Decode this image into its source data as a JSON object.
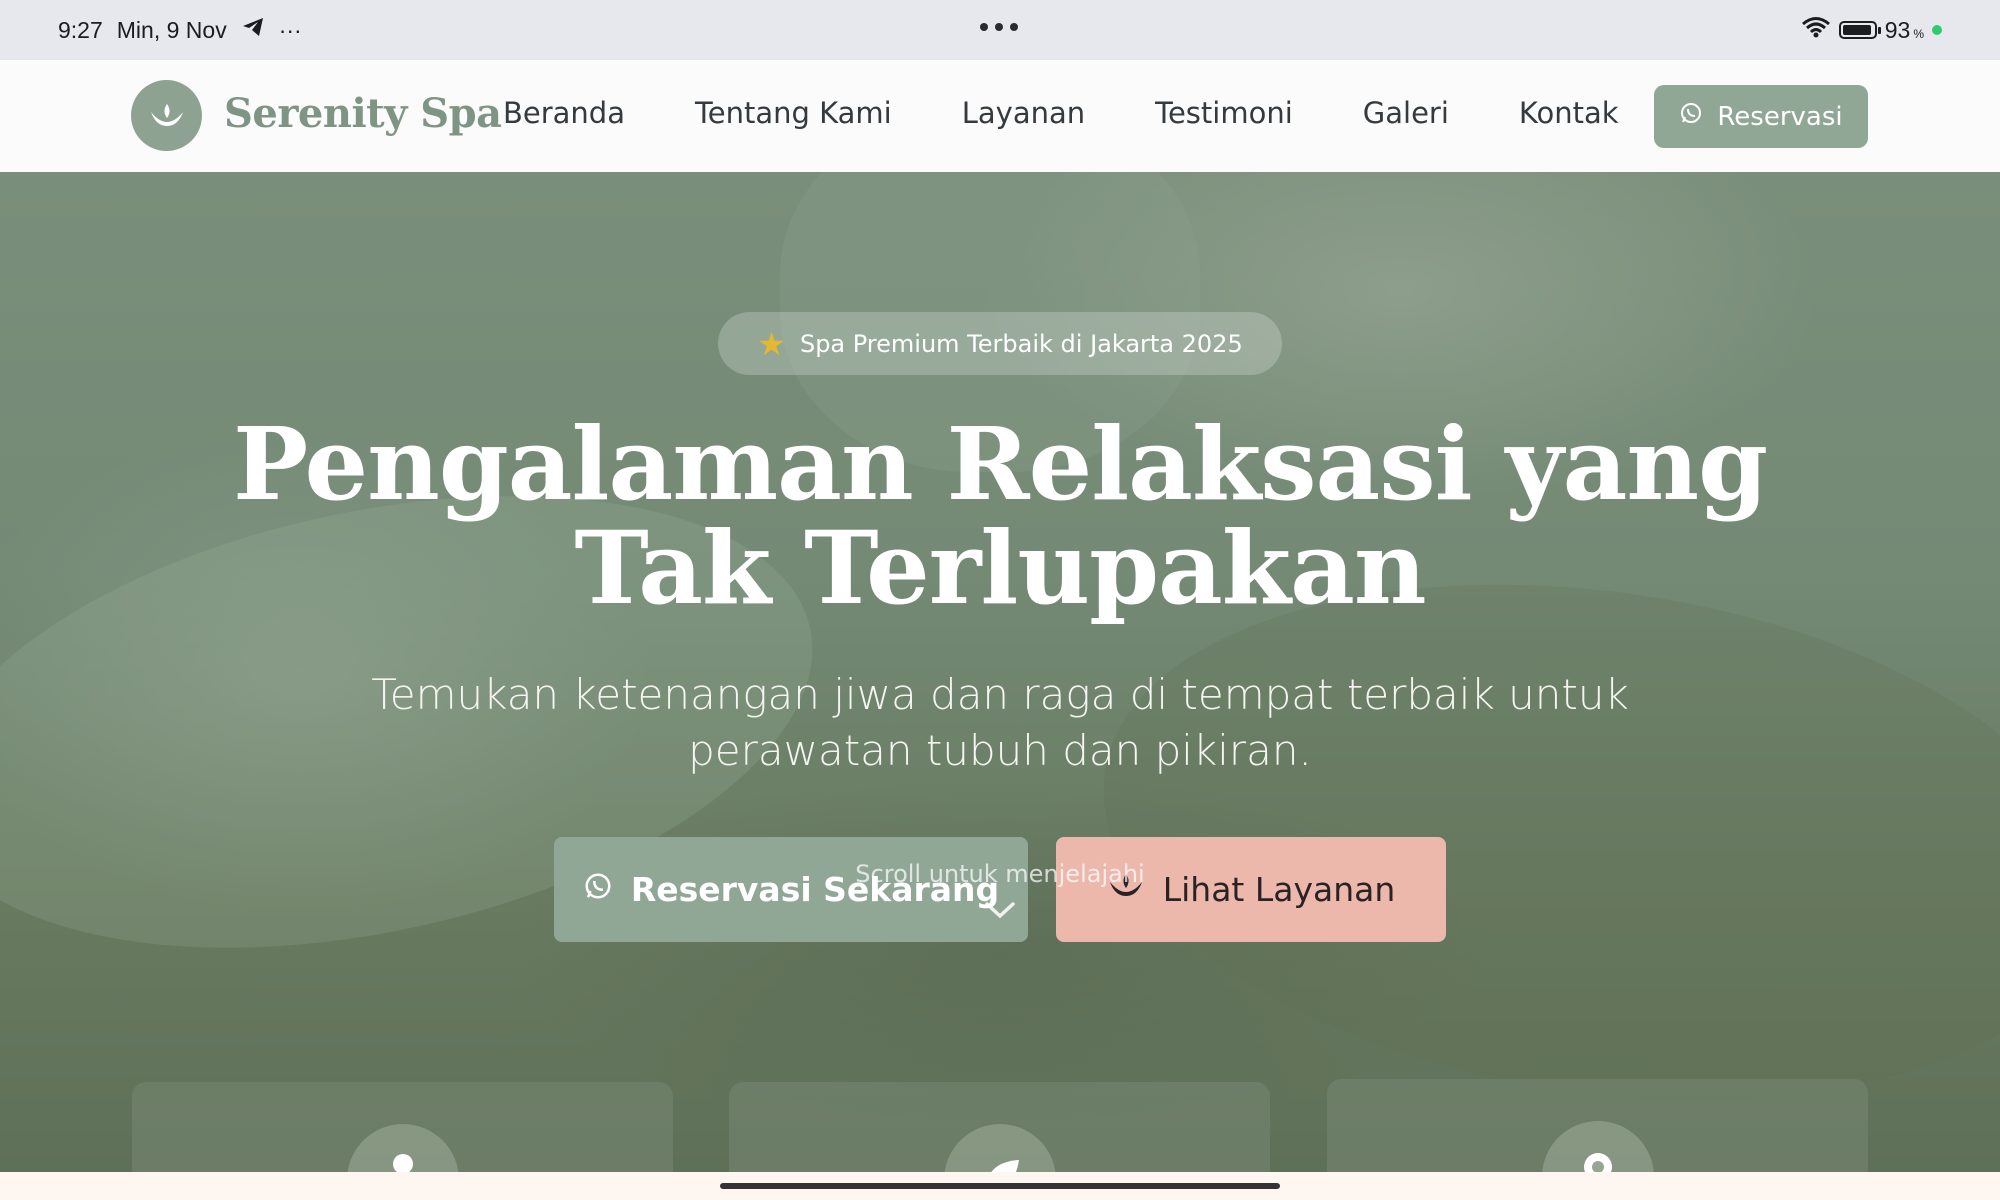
{
  "status_bar": {
    "time": "9:27",
    "date": "Min, 9 Nov",
    "more": "···",
    "battery_percent": "93",
    "battery_unit": "%",
    "battery_level": 0.93,
    "icons": [
      "telegram-icon",
      "wifi-icon",
      "battery-icon"
    ]
  },
  "navbar": {
    "brand": "Serenity Spa",
    "links": [
      "Beranda",
      "Tentang Kami",
      "Layanan",
      "Testimoni",
      "Galeri",
      "Kontak"
    ],
    "reserve_label": "Reservasi"
  },
  "hero": {
    "badge": "Spa Premium Terbaik di Jakarta 2025",
    "title_line1": "Pengalaman Relaksasi yang",
    "title_line2": "Tak Terlupakan",
    "subtitle_line1": "Temukan ketenangan jiwa dan raga di tempat terbaik untuk",
    "subtitle_line2": "perawatan tubuh dan pikiran.",
    "primary_button": "Reservasi Sekarang",
    "secondary_button": "Lihat Layanan",
    "scroll_hint": "Scroll untuk menjelajahi"
  },
  "features": {
    "icons": [
      "user-icon",
      "leaf-icon",
      "award-icon"
    ]
  },
  "colors": {
    "accent": "#91a796",
    "secondary_button": "#ecb8ab",
    "brand_text": "#7f9584",
    "badge_star": "#e6b832",
    "charging_dot": "#2ecc71"
  }
}
